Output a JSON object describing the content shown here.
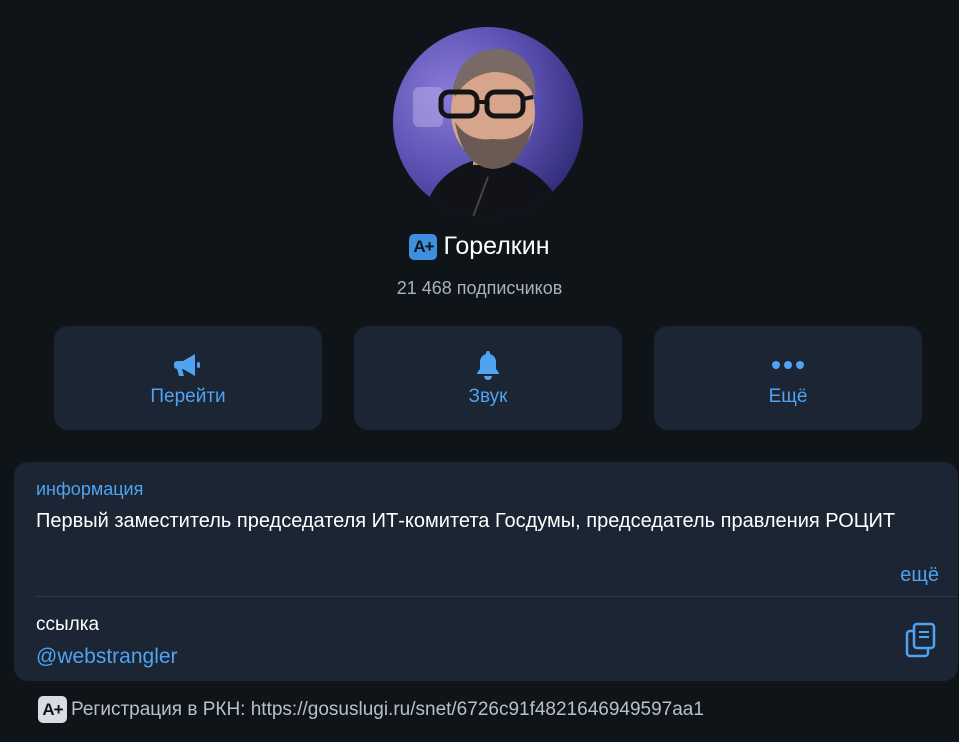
{
  "channel": {
    "badge": "A+",
    "name": "Горелкин",
    "subscribers": "21 468 подписчиков"
  },
  "actions": [
    {
      "label": "Перейти",
      "icon": "megaphone-icon"
    },
    {
      "label": "Звук",
      "icon": "bell-icon"
    },
    {
      "label": "Ещё",
      "icon": "more-icon"
    }
  ],
  "info": {
    "title": "информация",
    "text": "Первый заместитель председателя ИТ-комитета Госдумы, председатель правления РОЦИТ",
    "more": "ещё",
    "link_label": "ссылка",
    "link_value": "@webstrangler"
  },
  "footer": {
    "badge": "A+",
    "text": "Регистрация в РКН: https://gosuslugi.ru/snet/6726c91f4821646949597aa1"
  },
  "colors": {
    "background": "#0f1419",
    "card": "#1b2533",
    "accent": "#4fa3f0"
  }
}
